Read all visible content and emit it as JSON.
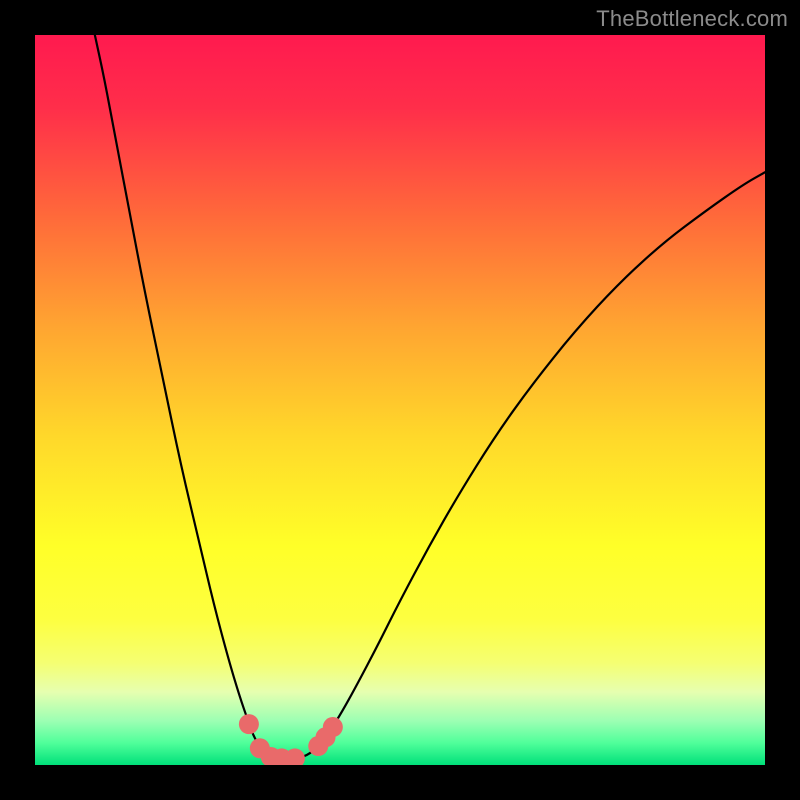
{
  "watermark": "TheBottleneck.com",
  "chart_data": {
    "type": "line",
    "title": "",
    "xlabel": "",
    "ylabel": "",
    "xlim": [
      0,
      100
    ],
    "ylim": [
      0,
      100
    ],
    "gradient_stops": [
      {
        "offset": 0.0,
        "color": "#ff1a4f"
      },
      {
        "offset": 0.1,
        "color": "#ff2e4a"
      },
      {
        "offset": 0.25,
        "color": "#ff6a3a"
      },
      {
        "offset": 0.4,
        "color": "#ffa531"
      },
      {
        "offset": 0.55,
        "color": "#ffd82a"
      },
      {
        "offset": 0.7,
        "color": "#ffff28"
      },
      {
        "offset": 0.8,
        "color": "#fdff40"
      },
      {
        "offset": 0.86,
        "color": "#f5ff72"
      },
      {
        "offset": 0.9,
        "color": "#e6ffb0"
      },
      {
        "offset": 0.94,
        "color": "#9bffb3"
      },
      {
        "offset": 0.97,
        "color": "#4fff9a"
      },
      {
        "offset": 1.0,
        "color": "#00e07a"
      }
    ],
    "series": [
      {
        "name": "curve",
        "points": [
          {
            "x": 8.2,
            "y": 100.0
          },
          {
            "x": 9.5,
            "y": 94.0
          },
          {
            "x": 11.0,
            "y": 86.0
          },
          {
            "x": 13.0,
            "y": 75.5
          },
          {
            "x": 15.0,
            "y": 65.0
          },
          {
            "x": 17.5,
            "y": 53.0
          },
          {
            "x": 20.0,
            "y": 41.0
          },
          {
            "x": 22.5,
            "y": 30.5
          },
          {
            "x": 24.5,
            "y": 22.0
          },
          {
            "x": 26.5,
            "y": 14.5
          },
          {
            "x": 28.0,
            "y": 9.5
          },
          {
            "x": 29.2,
            "y": 6.0
          },
          {
            "x": 30.0,
            "y": 3.8
          },
          {
            "x": 31.0,
            "y": 2.2
          },
          {
            "x": 32.0,
            "y": 1.3
          },
          {
            "x": 33.0,
            "y": 0.9
          },
          {
            "x": 34.5,
            "y": 0.8
          },
          {
            "x": 36.0,
            "y": 0.9
          },
          {
            "x": 37.2,
            "y": 1.3
          },
          {
            "x": 38.2,
            "y": 2.0
          },
          {
            "x": 39.3,
            "y": 3.2
          },
          {
            "x": 40.5,
            "y": 4.8
          },
          {
            "x": 42.0,
            "y": 7.2
          },
          {
            "x": 44.0,
            "y": 10.8
          },
          {
            "x": 47.0,
            "y": 16.5
          },
          {
            "x": 50.0,
            "y": 22.5
          },
          {
            "x": 54.0,
            "y": 30.0
          },
          {
            "x": 58.0,
            "y": 37.0
          },
          {
            "x": 63.0,
            "y": 45.0
          },
          {
            "x": 68.0,
            "y": 52.0
          },
          {
            "x": 74.0,
            "y": 59.5
          },
          {
            "x": 80.0,
            "y": 66.0
          },
          {
            "x": 86.0,
            "y": 71.5
          },
          {
            "x": 92.0,
            "y": 76.0
          },
          {
            "x": 97.0,
            "y": 79.5
          },
          {
            "x": 100.0,
            "y": 81.2
          }
        ]
      }
    ],
    "markers": [
      {
        "x": 29.3,
        "y": 5.6
      },
      {
        "x": 30.8,
        "y": 2.3
      },
      {
        "x": 32.3,
        "y": 1.1
      },
      {
        "x": 33.8,
        "y": 0.9
      },
      {
        "x": 35.6,
        "y": 0.9
      },
      {
        "x": 38.8,
        "y": 2.6
      },
      {
        "x": 39.8,
        "y": 3.8
      },
      {
        "x": 40.8,
        "y": 5.2
      }
    ],
    "marker_color": "#e96a6a",
    "marker_radius_px": 10
  }
}
